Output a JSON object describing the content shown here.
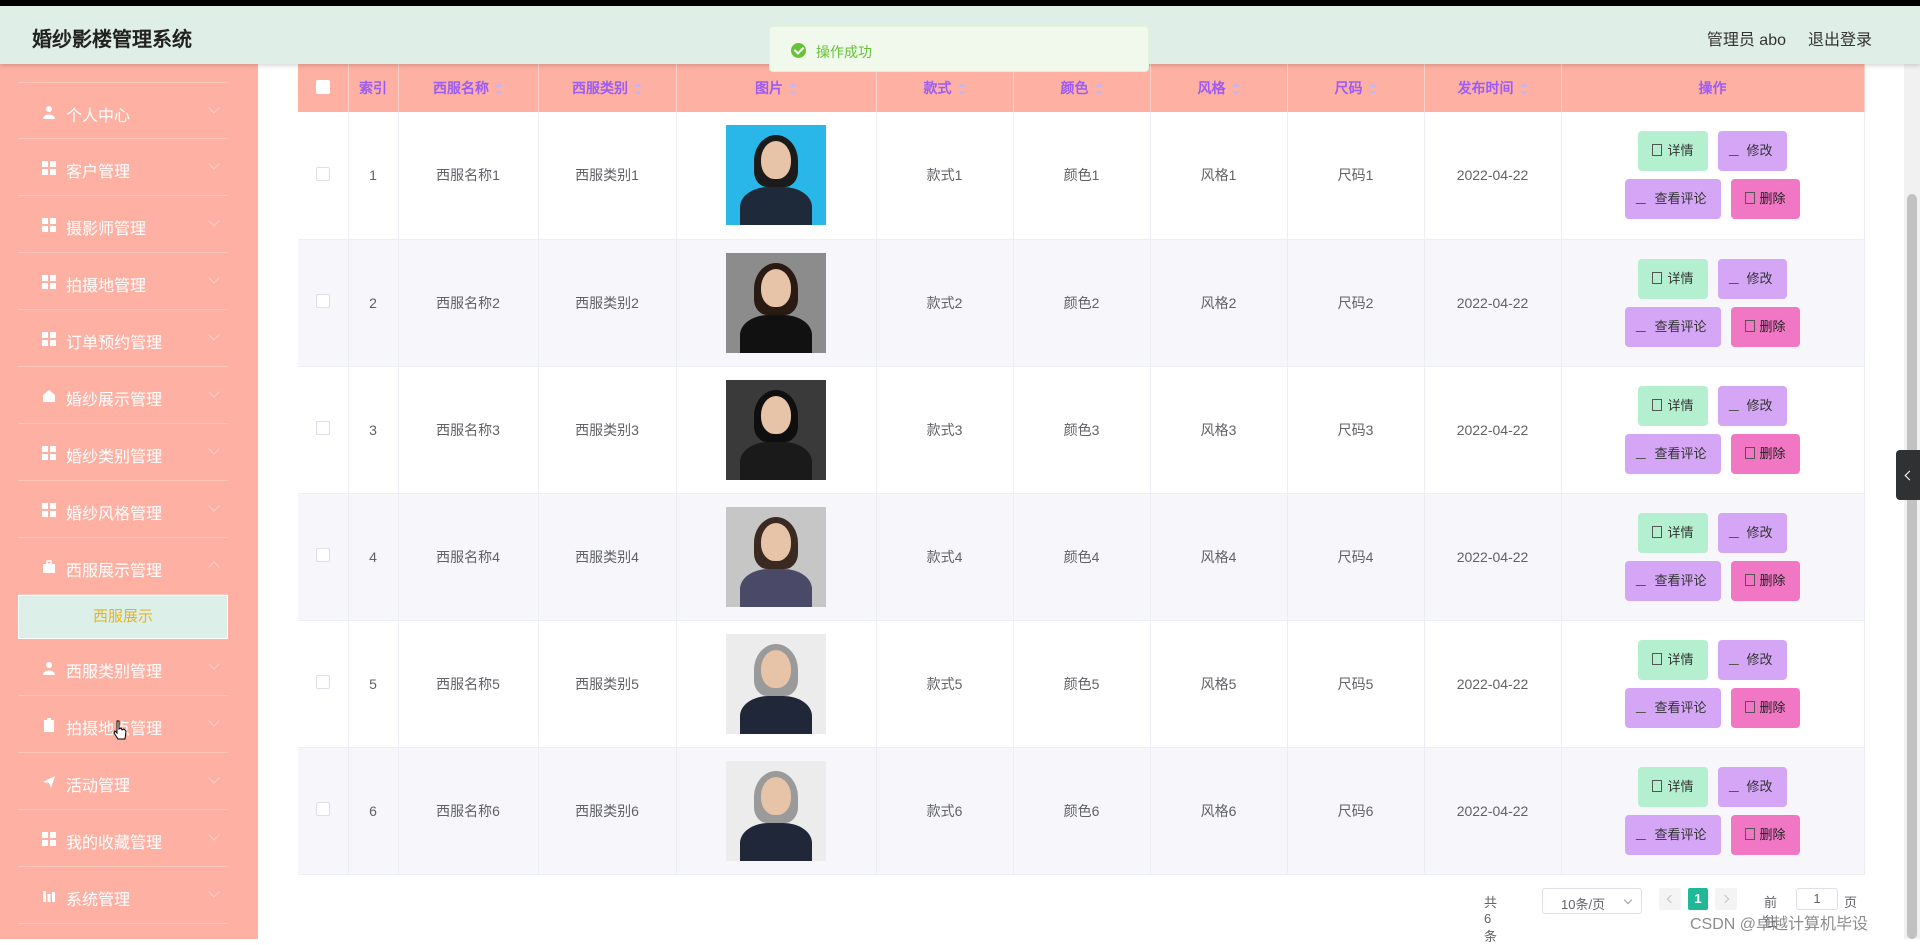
{
  "header": {
    "title": "婚纱影楼管理系统",
    "user": "管理员 abo",
    "logout": "退出登录"
  },
  "toast": {
    "text": "操作成功"
  },
  "sidebar": {
    "items": [
      {
        "label": "个人中心",
        "icon": "user-icon"
      },
      {
        "label": "客户管理",
        "icon": "grid-icon"
      },
      {
        "label": "摄影师管理",
        "icon": "grid-icon"
      },
      {
        "label": "拍摄地管理",
        "icon": "grid-icon"
      },
      {
        "label": "订单预约管理",
        "icon": "grid-icon"
      },
      {
        "label": "婚纱展示管理",
        "icon": "shop-icon"
      },
      {
        "label": "婚纱类别管理",
        "icon": "grid-icon"
      },
      {
        "label": "婚纱风格管理",
        "icon": "grid-icon"
      },
      {
        "label": "西服展示管理",
        "icon": "briefcase-icon"
      },
      {
        "label": "西服类别管理",
        "icon": "user-icon"
      },
      {
        "label": "拍摄地点管理",
        "icon": "clipboard-icon"
      },
      {
        "label": "活动管理",
        "icon": "send-icon"
      },
      {
        "label": "我的收藏管理",
        "icon": "grid-icon"
      },
      {
        "label": "系统管理",
        "icon": "chart-icon"
      }
    ],
    "active_sub": "西服展示"
  },
  "table": {
    "headers": [
      "索引",
      "西服名称",
      "西服类别",
      "图片",
      "款式",
      "颜色",
      "风格",
      "尺码",
      "发布时间",
      "操作"
    ],
    "rows": [
      {
        "index": "1",
        "name": "西服名称1",
        "category": "西服类别1",
        "style": "款式1",
        "color": "颜色1",
        "type": "风格1",
        "size": "尺码1",
        "date": "2022-04-22"
      },
      {
        "index": "2",
        "name": "西服名称2",
        "category": "西服类别2",
        "style": "款式2",
        "color": "颜色2",
        "type": "风格2",
        "size": "尺码2",
        "date": "2022-04-22"
      },
      {
        "index": "3",
        "name": "西服名称3",
        "category": "西服类别3",
        "style": "款式3",
        "color": "颜色3",
        "type": "风格3",
        "size": "尺码3",
        "date": "2022-04-22"
      },
      {
        "index": "4",
        "name": "西服名称4",
        "category": "西服类别4",
        "style": "款式4",
        "color": "颜色4",
        "type": "风格4",
        "size": "尺码4",
        "date": "2022-04-22"
      },
      {
        "index": "5",
        "name": "西服名称5",
        "category": "西服类别5",
        "style": "款式5",
        "color": "颜色5",
        "type": "风格5",
        "size": "尺码5",
        "date": "2022-04-22"
      },
      {
        "index": "6",
        "name": "西服名称6",
        "category": "西服类别6",
        "style": "款式6",
        "color": "颜色6",
        "type": "风格6",
        "size": "尺码6",
        "date": "2022-04-22"
      }
    ],
    "actions": {
      "detail": "详情",
      "edit": "修改",
      "comment": "查看评论",
      "delete": "删除"
    }
  },
  "pager": {
    "total": "共 6 条",
    "page_size": "10条/页",
    "current_page": "1",
    "goto_label": "前往",
    "goto_value": "1",
    "page_unit": "页"
  },
  "watermark": "CSDN @卓越计算机毕设",
  "colors": {
    "header_bg": "#dfeee6",
    "sidebar_bg": "#feb1a3",
    "table_header_bg": "#feb1a3",
    "header_text": "#9c5cf5",
    "detail_btn": "#b4f0cf",
    "edit_btn": "#d5a6f5",
    "delete_btn": "#f176c3",
    "active_page": "#1fb998"
  }
}
